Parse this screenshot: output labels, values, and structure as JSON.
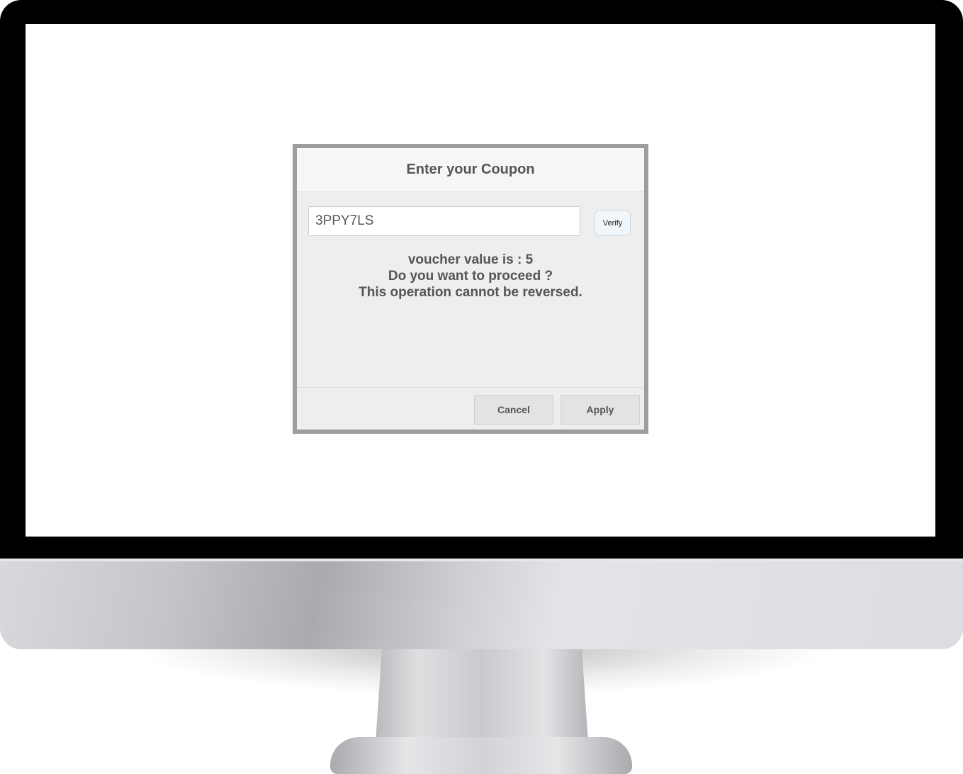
{
  "dialog": {
    "title": "Enter your Coupon",
    "coupon_value": "3PPY7LS",
    "verify_label": "Verify",
    "message_lines": [
      "voucher value is : 5",
      "Do you want to proceed ?",
      "This operation cannot be reversed."
    ],
    "cancel_label": "Cancel",
    "apply_label": "Apply"
  },
  "colors": {
    "bezel": "#000000",
    "dialog_border": "#9d9d9d",
    "dialog_background": "#eeeeee",
    "text": "#555555",
    "verify_background": "#f1f6fb"
  }
}
